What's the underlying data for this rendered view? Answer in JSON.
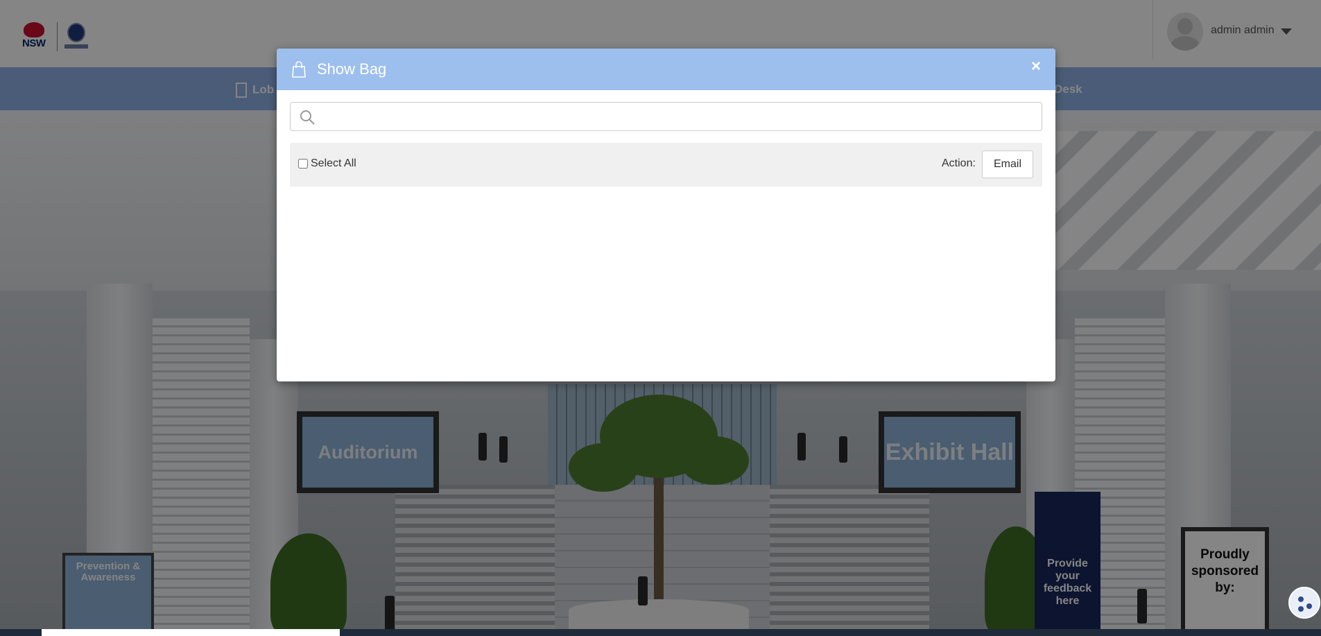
{
  "header": {
    "logo_nsw_text": "NSW",
    "user_name": "admin admin"
  },
  "nav": {
    "items": [
      {
        "label": "Lob",
        "icon": "building-icon"
      },
      {
        "label": "Desk",
        "icon": ""
      }
    ]
  },
  "scene": {
    "auditorium_label": "Auditorium",
    "exhibit_hall_label": "Exhibit Hall",
    "prevention_label": "Prevention & Awareness",
    "feedback_label": "Provide your feedback here",
    "sponsored_label": "Proudly sponsored by:"
  },
  "modal": {
    "title": "Show Bag",
    "close_label": "×",
    "search": {
      "placeholder": "",
      "value": ""
    },
    "select_all_label": "Select All",
    "select_all_checked": false,
    "action_label": "Action:",
    "email_button_label": "Email"
  },
  "colors": {
    "modal_header": "#9dbfee",
    "nav_bar": "#8fb0e6",
    "overlay": "rgba(0,0,0,0.48)"
  }
}
